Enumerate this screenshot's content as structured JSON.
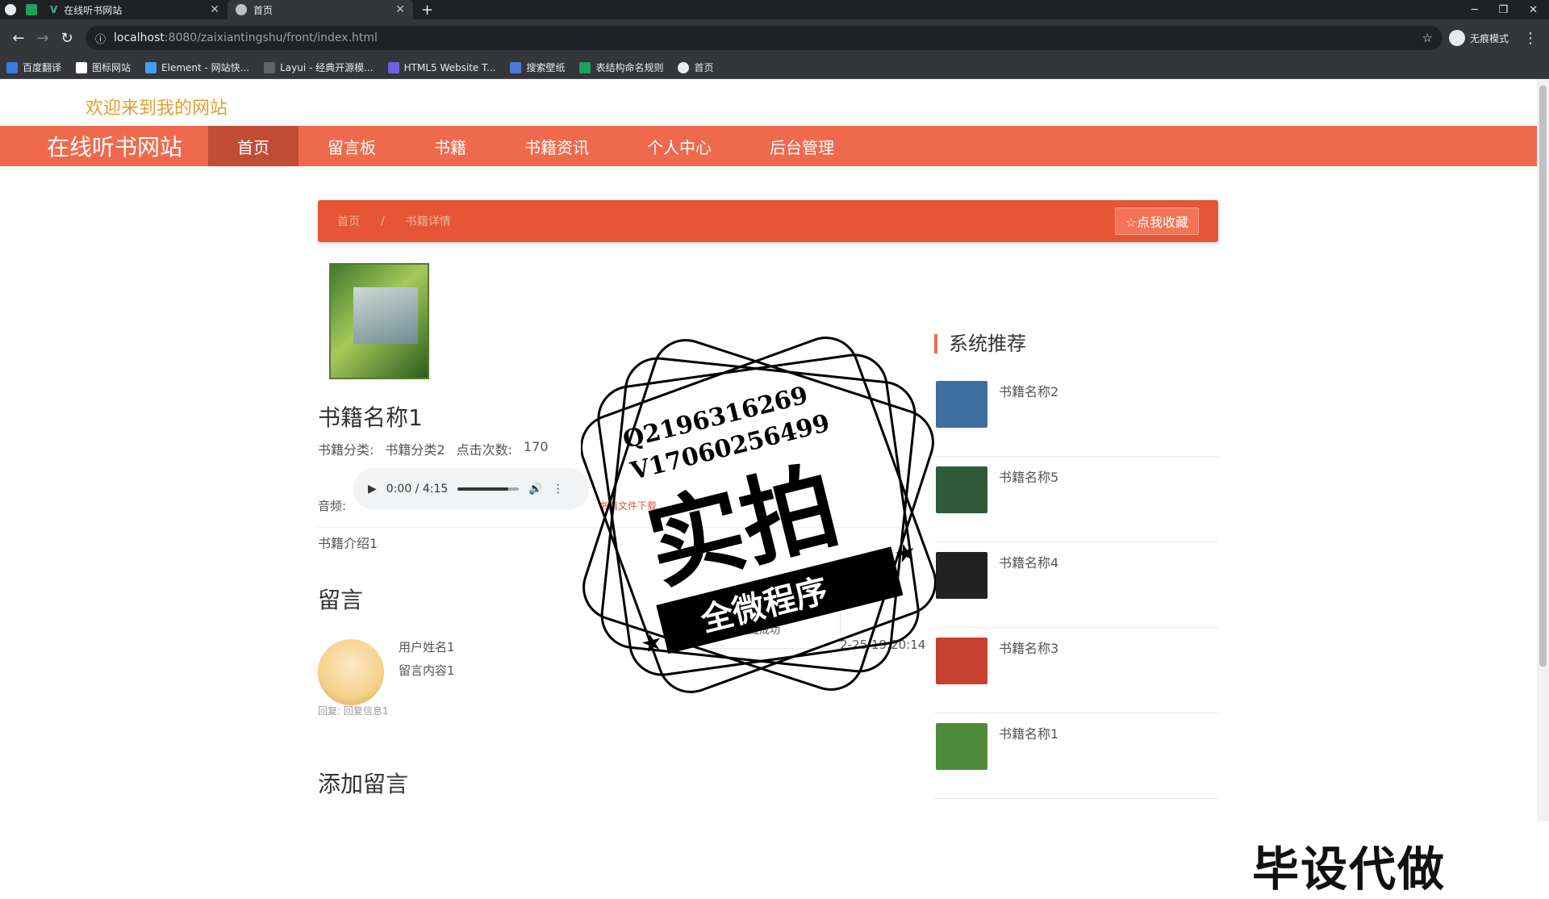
{
  "browser": {
    "tabs": [
      {
        "title": "在线听书网站",
        "active": false
      },
      {
        "title": "首页",
        "active": true
      }
    ],
    "new_tab": "+",
    "window_controls": [
      "─",
      "❐",
      "✕"
    ],
    "url_host": "localhost",
    "url_path": ":8080/zaixiantingshu/front/index.html",
    "incognito_label": "无痕模式",
    "bookmarks": [
      {
        "label": "百度翻译",
        "color": "#3a7be0"
      },
      {
        "label": "图标网站",
        "color": "#ffffff"
      },
      {
        "label": "Element - 网站快...",
        "color": "#409eff"
      },
      {
        "label": "Layui - 经典开源模...",
        "color": "#5f6368"
      },
      {
        "label": "HTML5 Website T...",
        "color": "#6f5fe0"
      },
      {
        "label": "搜索壁纸",
        "color": "#4a7bd8"
      },
      {
        "label": "表结构命名规则",
        "color": "#1aa260"
      },
      {
        "label": "首页",
        "color": "#e8eaed"
      }
    ]
  },
  "header": {
    "welcome": "欢迎来到我的网站",
    "site_title": "在线听书网站",
    "nav": [
      "首页",
      "留言板",
      "书籍",
      "书籍资讯",
      "个人中心",
      "后台管理"
    ],
    "active_index": 0,
    "accent": "#ef6a4d"
  },
  "breadcrumb": {
    "home": "首页",
    "sep": "/",
    "current": "书籍详情",
    "favorite_button": "☆点我收藏"
  },
  "book": {
    "title": "书籍名称1",
    "category_label": "书籍分类:",
    "category": "书籍分类2",
    "clicks_label": "点击次数:",
    "clicks": "170",
    "audio_label": "音频:",
    "time": "0:00 / 4:15",
    "progress": 0.82,
    "download": "书籍文件下载",
    "intro": "书籍介绍1"
  },
  "comments": {
    "title": "留言",
    "items": [
      {
        "user": "用户姓名1",
        "content": "留言内容1",
        "time": "2022-02-25 19:20:14",
        "reply": "回复: 回复信息1"
      }
    ],
    "add_title": "添加留言"
  },
  "toast": {
    "text": "收藏成功"
  },
  "recommend": {
    "title": "系统推荐",
    "items": [
      {
        "name": "书籍名称2",
        "color": "#3e6fa0"
      },
      {
        "name": "书籍名称5",
        "color": "#2f5a3a"
      },
      {
        "name": "书籍名称4",
        "color": "#222222"
      },
      {
        "name": "书籍名称3",
        "color": "#c8402e"
      },
      {
        "name": "书籍名称1",
        "color": "#4f8a3a"
      }
    ]
  },
  "watermark": {
    "line1": "Q2196316269",
    "line2": "V17060256499",
    "big": "实拍",
    "ribbon": "全微程序",
    "corner": "毕设代做"
  }
}
